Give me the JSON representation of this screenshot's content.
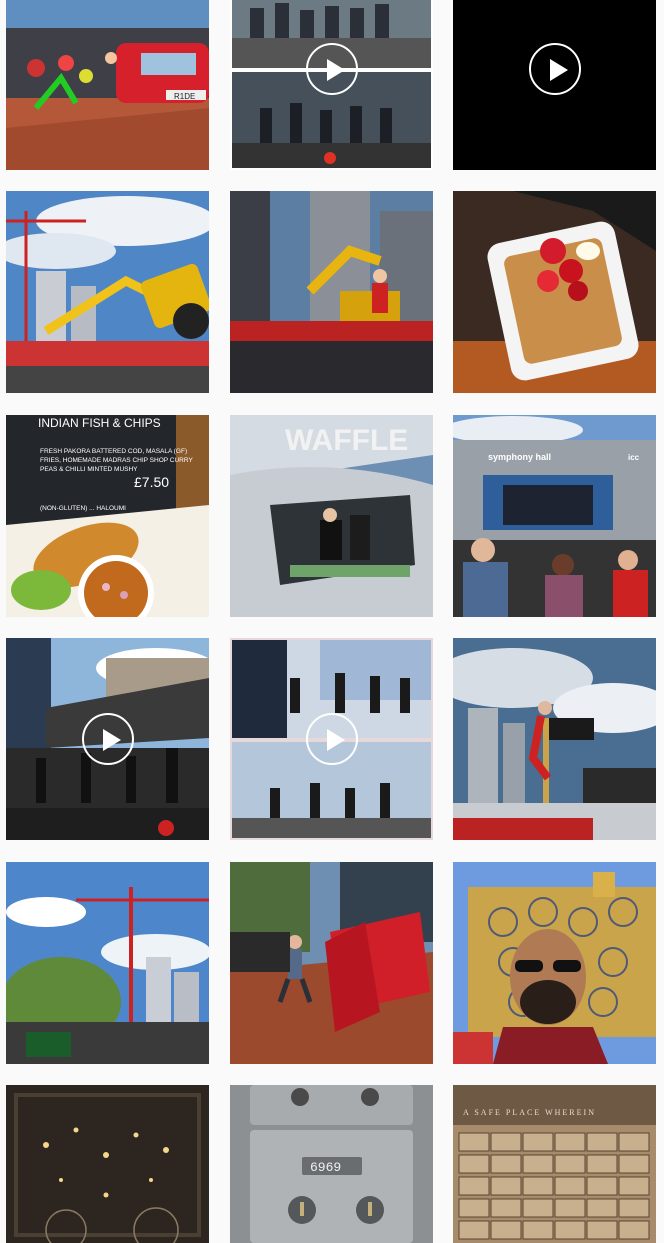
{
  "grid": {
    "posts": [
      {
        "alt": "street performers and red car",
        "video": false
      },
      {
        "alt": "dance crew on stage collage",
        "video": true
      },
      {
        "alt": "black video frame",
        "video": true
      },
      {
        "alt": "crane and digger stunt",
        "video": false
      },
      {
        "alt": "digger and performer on stage",
        "video": false
      },
      {
        "alt": "strawberry waffle in tray",
        "video": false
      },
      {
        "alt": "indian fish and chips",
        "video": false
      },
      {
        "alt": "waffle van interior",
        "video": false
      },
      {
        "alt": "symphony hall stage crowd",
        "video": false
      },
      {
        "alt": "dancers on outdoor stage",
        "video": true
      },
      {
        "alt": "dance performance collage",
        "video": true
      },
      {
        "alt": "acrobat on pole with dramatic sky",
        "video": false
      },
      {
        "alt": "crane over trees and buildings",
        "video": false
      },
      {
        "alt": "performer with red car parts",
        "video": false
      },
      {
        "alt": "selfie at library of birmingham",
        "video": false
      },
      {
        "alt": "dark ornate ceiling with lights",
        "video": false
      },
      {
        "alt": "vintage safe deposit box 6969",
        "video": false
      },
      {
        "alt": "wall of safe deposit boxes",
        "video": false
      }
    ]
  },
  "texts": {
    "fish_board_title": "INDIAN FISH & CHIPS",
    "fish_board_line1": "FRESH PAKORA BATTERED COD, MASALA (GF)",
    "fish_board_line2": "FRIES, HOMEMADE MADRAS CHIP SHOP CURRY",
    "fish_board_line3": "PEAS & CHILLI MINTED MUSHY",
    "fish_board_price": "£7.50",
    "fish_board_line4": "(NON-GLUTEN) ... HALOUMI",
    "waffle_sign": "WAFFLE",
    "hall_sign": "symphony hall",
    "hall_sign2": "icc",
    "car_plate": "R1DE",
    "safe_number": "6969",
    "vault_inscription": "A SAFE PLACE WHEREIN"
  }
}
